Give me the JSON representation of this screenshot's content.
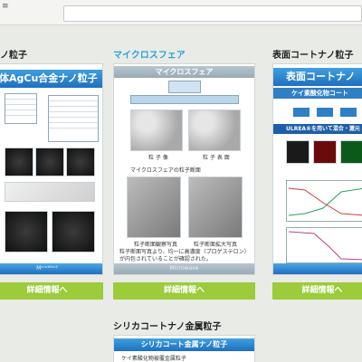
{
  "cards": [
    {
      "title": "ノ粒子",
      "poster_banner": "体AgCu合金ナノ粒子",
      "footer_text": "Mⁱᶜʳᵒᵂᴬᵛᴱ",
      "button": "詳細情報へ"
    },
    {
      "title": "マイクロスフェア",
      "poster_banner": "マイクロスフェア",
      "label_sphere_a": "粒 子 像",
      "label_sphere_b": "粒 子 表 面",
      "section_heading": "マイクロスフェアの粒子断面",
      "caption_left": "粒子断面観察写真",
      "caption_right": "粒子断面拡大写真",
      "note": "粒子断面写真より、均一に高濃度（プロゲステロン）が内包されていることが確認された。",
      "footer_text": "Microwave",
      "button": "詳細情報へ"
    },
    {
      "title": "表面コートナノ粒子",
      "poster_banner": "表面コートナノ",
      "sub_banner": "ケイ素酸化物コート",
      "ulrea_line": "ULREA®を用いて混合・還元・被覆",
      "button": "詳細情報へ"
    },
    {
      "title": "シリカコートナノ金属粒子",
      "poster_banner": "シリカコート金属ナノ粒子",
      "subline": "ケイ素酸化物被覆金属粒子"
    }
  ],
  "colors": {
    "accent_blue": "#2aa3d4",
    "button_green": "#9ccb3b",
    "banner_blue": "#1f6fbe"
  }
}
